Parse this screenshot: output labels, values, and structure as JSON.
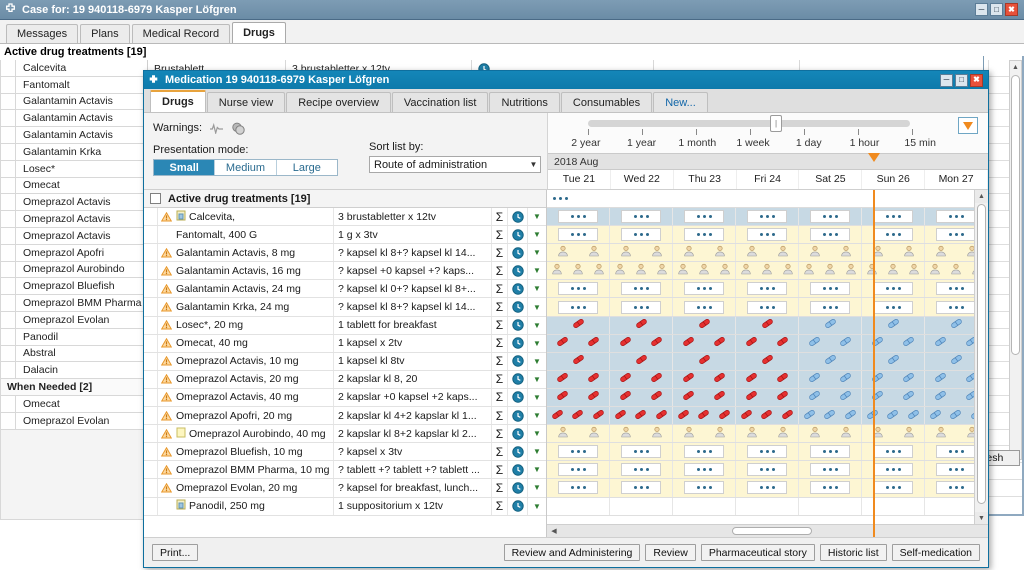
{
  "background": {
    "title": "Case for: 19 940118-6979 Kasper Löfgren",
    "title_icon": "clover-icon",
    "window_buttons": [
      "minimize",
      "maximize",
      "close"
    ],
    "tabs": [
      {
        "label": "Messages",
        "active": false
      },
      {
        "label": "Plans",
        "active": false
      },
      {
        "label": "Medical Record",
        "active": false
      },
      {
        "label": "Drugs",
        "active": true
      }
    ],
    "section_title": "Active drug treatments  [19]",
    "list_items": [
      "Calcevita",
      "Fantomalt",
      "Galantamin Actavis",
      "Galantamin Actavis",
      "Galantamin Actavis",
      "Galantamin Krka",
      "Losec*",
      "Omecat",
      "Omeprazol Actavis",
      "Omeprazol Actavis",
      "Omeprazol Actavis",
      "Omeprazol Apofri",
      "Omeprazol Aurobindo",
      "Omeprazol Bluefish",
      "Omeprazol BMM Pharma",
      "Omeprazol Evolan",
      "Panodil",
      "Abstral",
      "Dalacin"
    ],
    "group_label": "When Needed  [2]",
    "group_items": [
      "Omecat",
      "Omeprazol Evolan"
    ],
    "first_row": {
      "name": "Brustablett",
      "dose": "3 brustabletter x 12tv"
    },
    "refresh_label": "fresh"
  },
  "modal": {
    "title": "Medication 19 940118-6979 Kasper Löfgren",
    "title_icon": "cross-icon",
    "window_buttons": [
      "minimize",
      "maximize",
      "close"
    ],
    "tabs": [
      {
        "label": "Drugs",
        "active": true
      },
      {
        "label": "Nurse view",
        "active": false
      },
      {
        "label": "Recipe overview",
        "active": false
      },
      {
        "label": "Vaccination list",
        "active": false
      },
      {
        "label": "Nutritions",
        "active": false
      },
      {
        "label": "Consumables",
        "active": false
      },
      {
        "label": "New...",
        "active": false,
        "link": true
      }
    ],
    "toolbar": {
      "warnings_label": "Warnings:",
      "warning_icons": [
        "interaction-icon",
        "duplicate-icon"
      ],
      "presentation_label": "Presentation mode:",
      "presentation_options": [
        "Small",
        "Medium",
        "Large"
      ],
      "presentation_selected": "Small",
      "sort_label": "Sort list by:",
      "sort_value": "Route of administration"
    },
    "timeline": {
      "zoom_levels": [
        "2 year",
        "1 year",
        "1 month",
        "1 week",
        "1 day",
        "1 hour",
        "15 min"
      ],
      "zoom_selected": "1 week",
      "calendar_icon": "orange-triangle-icon",
      "month": "2018 Aug",
      "days": [
        "Tue 21",
        "Wed 22",
        "Thu 23",
        "Fri 24",
        "Sat 25",
        "Sun 26",
        "Mon 27"
      ],
      "now_marker_day": "Fri 24"
    },
    "grid_header": {
      "checkbox": false,
      "label": "Active drug treatments [19]"
    },
    "rows": [
      {
        "warn": true,
        "icon": "suppository-icon",
        "name": "Calcevita,",
        "dose": "3 brustabletter x 12tv",
        "band": "blue",
        "marks": "dots"
      },
      {
        "warn": false,
        "icon": "",
        "name": "Fantomalt, 400 G",
        "dose": "1 g x 3tv",
        "band": "yellow",
        "marks": "dots"
      },
      {
        "warn": true,
        "icon": "",
        "name": "Galantamin Actavis, 8 mg",
        "dose": "? kapsel kl 8+? kapsel kl 14...",
        "band": "yellow",
        "marks": "person2"
      },
      {
        "warn": true,
        "icon": "",
        "name": "Galantamin Actavis, 16 mg",
        "dose": "? kapsel +0 kapsel +? kaps...",
        "band": "yellow",
        "marks": "person3"
      },
      {
        "warn": true,
        "icon": "",
        "name": "Galantamin Actavis, 24 mg",
        "dose": "? kapsel kl 0+? kapsel kl 8+...",
        "band": "yellow",
        "marks": "dots"
      },
      {
        "warn": true,
        "icon": "",
        "name": "Galantamin Krka, 24 mg",
        "dose": "? kapsel kl 8+? kapsel kl 14...",
        "band": "yellow",
        "marks": "dots"
      },
      {
        "warn": true,
        "icon": "",
        "name": "Losec*, 20 mg",
        "dose": "1 tablett for breakfast",
        "band": "blue",
        "marks": "pill1"
      },
      {
        "warn": true,
        "icon": "",
        "name": "Omecat, 40 mg",
        "dose": "1 kapsel x 2tv",
        "band": "blue",
        "marks": "pill2"
      },
      {
        "warn": true,
        "icon": "",
        "name": "Omeprazol Actavis, 10 mg",
        "dose": "1 kapsel kl 8tv",
        "band": "blue",
        "marks": "pill1"
      },
      {
        "warn": true,
        "icon": "",
        "name": "Omeprazol Actavis, 20 mg",
        "dose": "2 kapslar kl 8, 20",
        "band": "blue",
        "marks": "pill2"
      },
      {
        "warn": true,
        "icon": "",
        "name": "Omeprazol Actavis, 40 mg",
        "dose": "2 kapslar +0 kapsel +2 kaps...",
        "band": "blue",
        "marks": "pill2"
      },
      {
        "warn": true,
        "icon": "",
        "name": "Omeprazol Apofri, 20 mg",
        "dose": "2 kapslar kl 4+2 kapslar kl 1...",
        "band": "blue",
        "marks": "pill3"
      },
      {
        "warn": true,
        "icon": "note-icon",
        "name": "Omeprazol Aurobindo, 40 mg",
        "dose": "2 kapslar kl 8+2 kapslar kl 2...",
        "band": "yellow",
        "marks": "person2"
      },
      {
        "warn": true,
        "icon": "",
        "name": "Omeprazol Bluefish, 10 mg",
        "dose": "? kapsel  x 3tv",
        "band": "yellow",
        "marks": "dots"
      },
      {
        "warn": true,
        "icon": "",
        "name": "Omeprazol BMM Pharma, 10 mg",
        "dose": "? tablett +? tablett +? tablett ...",
        "band": "yellow",
        "marks": "dots"
      },
      {
        "warn": true,
        "icon": "",
        "name": "Omeprazol Evolan, 20 mg",
        "dose": "? kapsel for breakfast, lunch...",
        "band": "yellow",
        "marks": "dots"
      },
      {
        "warn": false,
        "icon": "suppository-icon",
        "name": "Panodil, 250 mg",
        "dose": "1 suppositorium x 12tv",
        "band": "white",
        "marks": "none"
      }
    ],
    "footer": {
      "print_label": "Print...",
      "buttons": [
        "Review and Administering",
        "Review",
        "Pharmaceutical story",
        "Historic list",
        "Self-medication"
      ]
    }
  },
  "colors": {
    "title_bar": "#0d7aab",
    "bg_title_bar": "#7d9cb4",
    "accent_orange": "#f08a1e",
    "band_blue": "#c7d9e4",
    "band_yellow": "#fdf6d3",
    "warning": "#f0a030",
    "pill_red": "#e02020",
    "pill_blue": "#6aa5d8"
  }
}
